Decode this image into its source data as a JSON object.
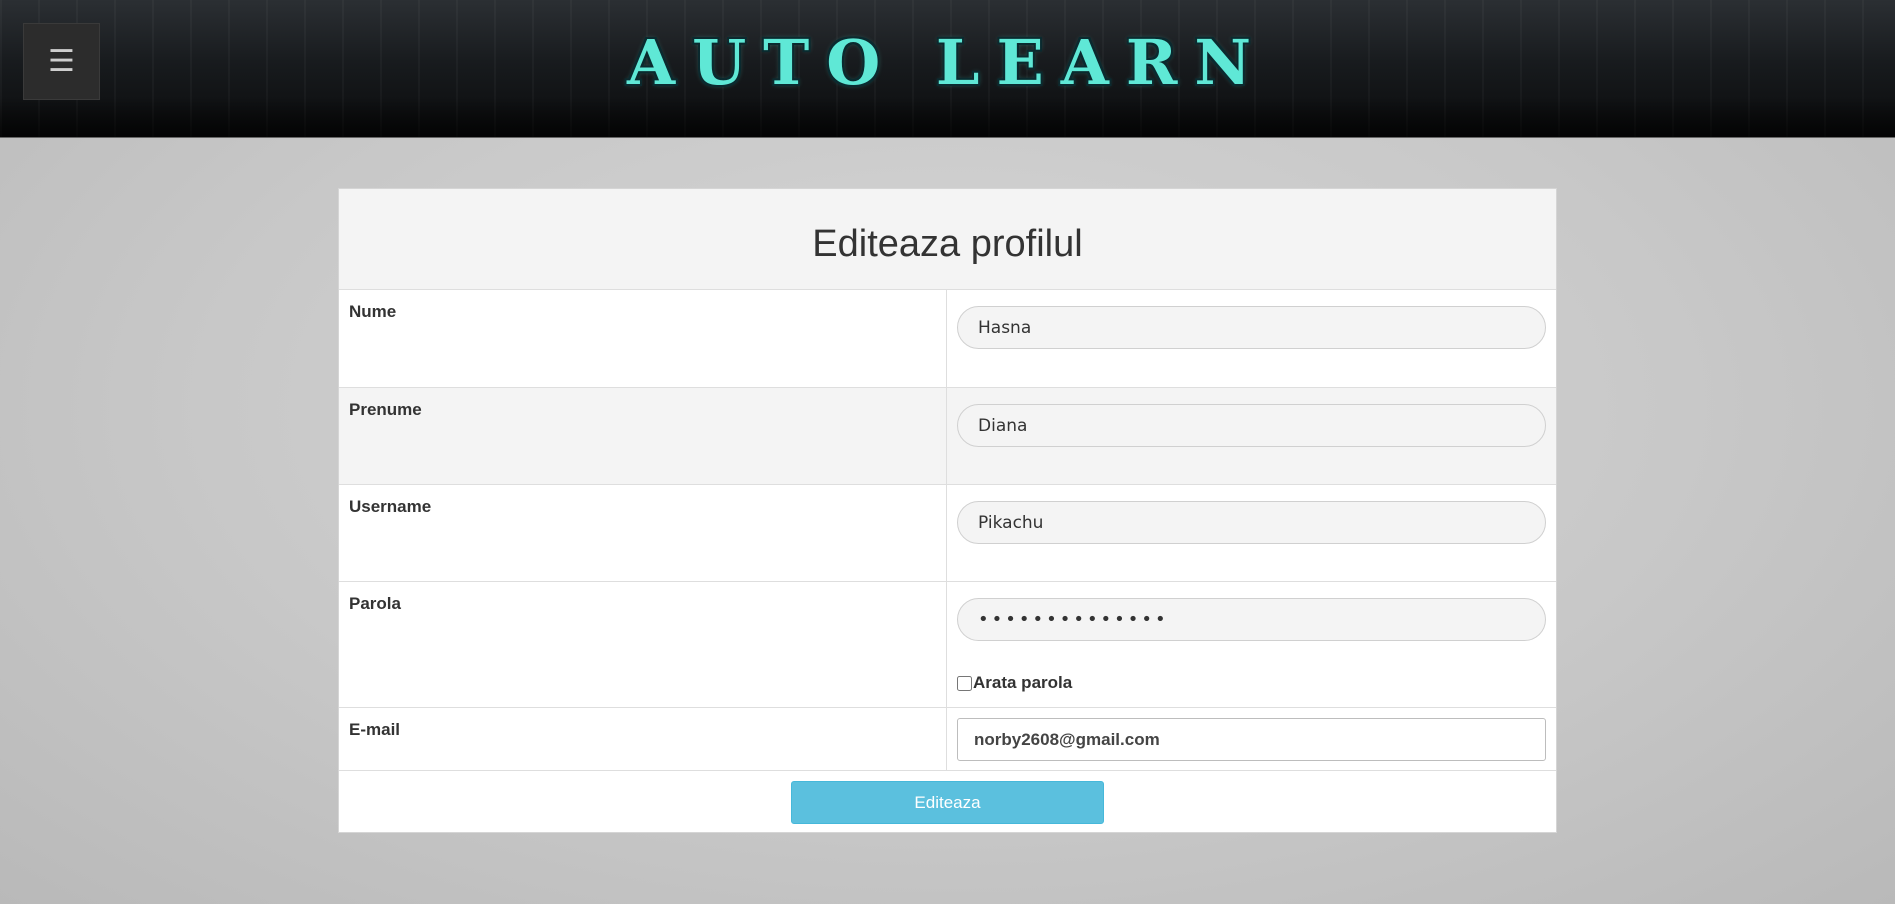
{
  "header": {
    "menu_icon": "☰",
    "logo_text": "AUTO LEARN"
  },
  "form": {
    "title": "Editeaza profilul",
    "fields": {
      "nume": {
        "label": "Nume",
        "value": "Hasna"
      },
      "prenume": {
        "label": "Prenume",
        "value": "Diana"
      },
      "username": {
        "label": "Username",
        "value": "Pikachu"
      },
      "parola": {
        "label": "Parola",
        "value": "••••••••••••••",
        "show_label": "Arata parola"
      },
      "email": {
        "label": "E-mail",
        "value": "norby2608@gmail.com"
      }
    },
    "submit_label": "Editeaza"
  },
  "colors": {
    "accent": "#5bc0de",
    "logo": "#5fe8d6"
  }
}
